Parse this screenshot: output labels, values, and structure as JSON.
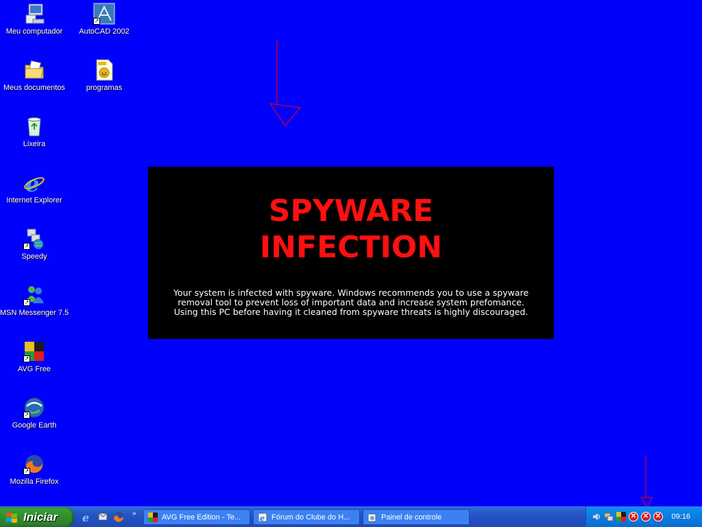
{
  "desktop": {
    "icons": [
      {
        "label": "Meu computador"
      },
      {
        "label": "AutoCAD 2002"
      },
      {
        "label": "Meus documentos"
      },
      {
        "label": "programas"
      },
      {
        "label": "Lixeira"
      },
      {
        "label": "Internet Explorer"
      },
      {
        "label": "Speedy"
      },
      {
        "label": "MSN Messenger 7.5"
      },
      {
        "label": "AVG Free"
      },
      {
        "label": "Google Earth"
      },
      {
        "label": "Mozilla Firefox"
      }
    ]
  },
  "banner": {
    "title_line1": "SPYWARE",
    "title_line2": "INFECTION",
    "message_line1": "Your system is infected with spyware. Windows recommends you to use a spyware",
    "message_line2": "removal tool to prevent loss of important data and increase system prefomance.",
    "message_line3": "Using this PC before having it cleaned from spyware threats is highly discouraged.",
    "title_color": "#ff1010"
  },
  "taskbar": {
    "start_label": "Iniciar",
    "tasks": [
      {
        "label": "AVG Free Edition - Te..."
      },
      {
        "label": "Fórum do Clube do H..."
      },
      {
        "label": "Painel de controle"
      }
    ],
    "clock": "09:16"
  },
  "colors": {
    "desktop_bg": "#0000fd",
    "banner_bg": "#000000",
    "taskbar": "#2453c5",
    "start_button": "#2f8f2f",
    "tray": "#0c7be0",
    "annotation_arrow": "#ff0000"
  }
}
